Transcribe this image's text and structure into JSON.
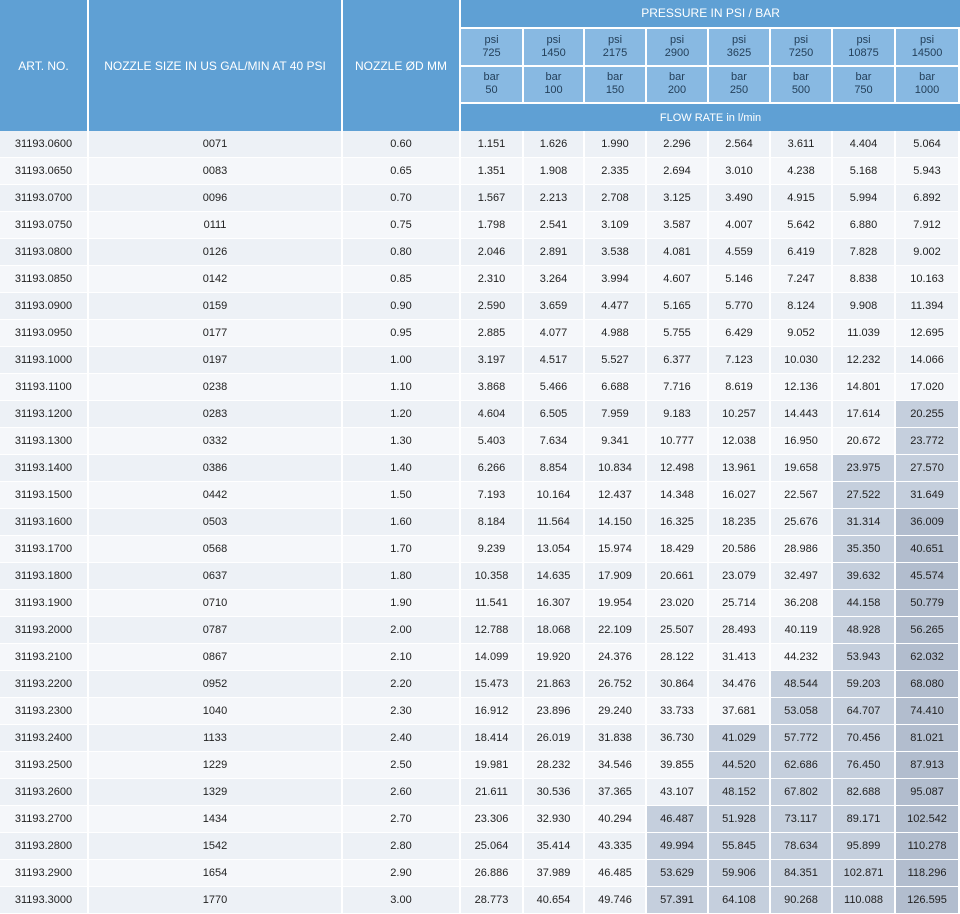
{
  "headers": {
    "art_no": "ART. NO.",
    "nozzle_size": "NOZZLE SIZE IN US GAL/MIN AT 40 PSI",
    "nozzle_d": "NOZZLE ØD MM",
    "pressure": "PRESSURE IN PSI / BAR",
    "flow_rate": "FLOW RATE in l/min",
    "pressures": [
      {
        "psi_unit": "psi",
        "psi": "725",
        "bar_unit": "bar",
        "bar": "50"
      },
      {
        "psi_unit": "psi",
        "psi": "1450",
        "bar_unit": "bar",
        "bar": "100"
      },
      {
        "psi_unit": "psi",
        "psi": "2175",
        "bar_unit": "bar",
        "bar": "150"
      },
      {
        "psi_unit": "psi",
        "psi": "2900",
        "bar_unit": "bar",
        "bar": "200"
      },
      {
        "psi_unit": "psi",
        "psi": "3625",
        "bar_unit": "bar",
        "bar": "250"
      },
      {
        "psi_unit": "psi",
        "psi": "7250",
        "bar_unit": "bar",
        "bar": "500"
      },
      {
        "psi_unit": "psi",
        "psi": "10875",
        "bar_unit": "bar",
        "bar": "750"
      },
      {
        "psi_unit": "psi",
        "psi": "14500",
        "bar_unit": "bar",
        "bar": "1000"
      }
    ]
  },
  "highlight_colors": {
    "level1": "#c5cfdd",
    "level2": "#b2bdce"
  },
  "rows": [
    {
      "art": "31193.0600",
      "size": "0071",
      "d": "0.60",
      "flows": [
        "1.151",
        "1.626",
        "1.990",
        "2.296",
        "2.564",
        "3.611",
        "4.404",
        "5.064"
      ],
      "hl": [
        0,
        0,
        0,
        0,
        0,
        0,
        0,
        0
      ]
    },
    {
      "art": "31193.0650",
      "size": "0083",
      "d": "0.65",
      "flows": [
        "1.351",
        "1.908",
        "2.335",
        "2.694",
        "3.010",
        "4.238",
        "5.168",
        "5.943"
      ],
      "hl": [
        0,
        0,
        0,
        0,
        0,
        0,
        0,
        0
      ]
    },
    {
      "art": "31193.0700",
      "size": "0096",
      "d": "0.70",
      "flows": [
        "1.567",
        "2.213",
        "2.708",
        "3.125",
        "3.490",
        "4.915",
        "5.994",
        "6.892"
      ],
      "hl": [
        0,
        0,
        0,
        0,
        0,
        0,
        0,
        0
      ]
    },
    {
      "art": "31193.0750",
      "size": "0111",
      "d": "0.75",
      "flows": [
        "1.798",
        "2.541",
        "3.109",
        "3.587",
        "4.007",
        "5.642",
        "6.880",
        "7.912"
      ],
      "hl": [
        0,
        0,
        0,
        0,
        0,
        0,
        0,
        0
      ]
    },
    {
      "art": "31193.0800",
      "size": "0126",
      "d": "0.80",
      "flows": [
        "2.046",
        "2.891",
        "3.538",
        "4.081",
        "4.559",
        "6.419",
        "7.828",
        "9.002"
      ],
      "hl": [
        0,
        0,
        0,
        0,
        0,
        0,
        0,
        0
      ]
    },
    {
      "art": "31193.0850",
      "size": "0142",
      "d": "0.85",
      "flows": [
        "2.310",
        "3.264",
        "3.994",
        "4.607",
        "5.146",
        "7.247",
        "8.838",
        "10.163"
      ],
      "hl": [
        0,
        0,
        0,
        0,
        0,
        0,
        0,
        0
      ]
    },
    {
      "art": "31193.0900",
      "size": "0159",
      "d": "0.90",
      "flows": [
        "2.590",
        "3.659",
        "4.477",
        "5.165",
        "5.770",
        "8.124",
        "9.908",
        "11.394"
      ],
      "hl": [
        0,
        0,
        0,
        0,
        0,
        0,
        0,
        0
      ]
    },
    {
      "art": "31193.0950",
      "size": "0177",
      "d": "0.95",
      "flows": [
        "2.885",
        "4.077",
        "4.988",
        "5.755",
        "6.429",
        "9.052",
        "11.039",
        "12.695"
      ],
      "hl": [
        0,
        0,
        0,
        0,
        0,
        0,
        0,
        0
      ]
    },
    {
      "art": "31193.1000",
      "size": "0197",
      "d": "1.00",
      "flows": [
        "3.197",
        "4.517",
        "5.527",
        "6.377",
        "7.123",
        "10.030",
        "12.232",
        "14.066"
      ],
      "hl": [
        0,
        0,
        0,
        0,
        0,
        0,
        0,
        0
      ]
    },
    {
      "art": "31193.1100",
      "size": "0238",
      "d": "1.10",
      "flows": [
        "3.868",
        "5.466",
        "6.688",
        "7.716",
        "8.619",
        "12.136",
        "14.801",
        "17.020"
      ],
      "hl": [
        0,
        0,
        0,
        0,
        0,
        0,
        0,
        0
      ]
    },
    {
      "art": "31193.1200",
      "size": "0283",
      "d": "1.20",
      "flows": [
        "4.604",
        "6.505",
        "7.959",
        "9.183",
        "10.257",
        "14.443",
        "17.614",
        "20.255"
      ],
      "hl": [
        0,
        0,
        0,
        0,
        0,
        0,
        0,
        1
      ]
    },
    {
      "art": "31193.1300",
      "size": "0332",
      "d": "1.30",
      "flows": [
        "5.403",
        "7.634",
        "9.341",
        "10.777",
        "12.038",
        "16.950",
        "20.672",
        "23.772"
      ],
      "hl": [
        0,
        0,
        0,
        0,
        0,
        0,
        0,
        1
      ]
    },
    {
      "art": "31193.1400",
      "size": "0386",
      "d": "1.40",
      "flows": [
        "6.266",
        "8.854",
        "10.834",
        "12.498",
        "13.961",
        "19.658",
        "23.975",
        "27.570"
      ],
      "hl": [
        0,
        0,
        0,
        0,
        0,
        0,
        1,
        1
      ]
    },
    {
      "art": "31193.1500",
      "size": "0442",
      "d": "1.50",
      "flows": [
        "7.193",
        "10.164",
        "12.437",
        "14.348",
        "16.027",
        "22.567",
        "27.522",
        "31.649"
      ],
      "hl": [
        0,
        0,
        0,
        0,
        0,
        0,
        1,
        1
      ]
    },
    {
      "art": "31193.1600",
      "size": "0503",
      "d": "1.60",
      "flows": [
        "8.184",
        "11.564",
        "14.150",
        "16.325",
        "18.235",
        "25.676",
        "31.314",
        "36.009"
      ],
      "hl": [
        0,
        0,
        0,
        0,
        0,
        0,
        1,
        2
      ]
    },
    {
      "art": "31193.1700",
      "size": "0568",
      "d": "1.70",
      "flows": [
        "9.239",
        "13.054",
        "15.974",
        "18.429",
        "20.586",
        "28.986",
        "35.350",
        "40.651"
      ],
      "hl": [
        0,
        0,
        0,
        0,
        0,
        0,
        1,
        2
      ]
    },
    {
      "art": "31193.1800",
      "size": "0637",
      "d": "1.80",
      "flows": [
        "10.358",
        "14.635",
        "17.909",
        "20.661",
        "23.079",
        "32.497",
        "39.632",
        "45.574"
      ],
      "hl": [
        0,
        0,
        0,
        0,
        0,
        0,
        1,
        2
      ]
    },
    {
      "art": "31193.1900",
      "size": "0710",
      "d": "1.90",
      "flows": [
        "11.541",
        "16.307",
        "19.954",
        "23.020",
        "25.714",
        "36.208",
        "44.158",
        "50.779"
      ],
      "hl": [
        0,
        0,
        0,
        0,
        0,
        0,
        1,
        2
      ]
    },
    {
      "art": "31193.2000",
      "size": "0787",
      "d": "2.00",
      "flows": [
        "12.788",
        "18.068",
        "22.109",
        "25.507",
        "28.493",
        "40.119",
        "48.928",
        "56.265"
      ],
      "hl": [
        0,
        0,
        0,
        0,
        0,
        0,
        1,
        2
      ]
    },
    {
      "art": "31193.2100",
      "size": "0867",
      "d": "2.10",
      "flows": [
        "14.099",
        "19.920",
        "24.376",
        "28.122",
        "31.413",
        "44.232",
        "53.943",
        "62.032"
      ],
      "hl": [
        0,
        0,
        0,
        0,
        0,
        0,
        1,
        2
      ]
    },
    {
      "art": "31193.2200",
      "size": "0952",
      "d": "2.20",
      "flows": [
        "15.473",
        "21.863",
        "26.752",
        "30.864",
        "34.476",
        "48.544",
        "59.203",
        "68.080"
      ],
      "hl": [
        0,
        0,
        0,
        0,
        0,
        1,
        1,
        2
      ]
    },
    {
      "art": "31193.2300",
      "size": "1040",
      "d": "2.30",
      "flows": [
        "16.912",
        "23.896",
        "29.240",
        "33.733",
        "37.681",
        "53.058",
        "64.707",
        "74.410"
      ],
      "hl": [
        0,
        0,
        0,
        0,
        0,
        1,
        1,
        2
      ]
    },
    {
      "art": "31193.2400",
      "size": "1133",
      "d": "2.40",
      "flows": [
        "18.414",
        "26.019",
        "31.838",
        "36.730",
        "41.029",
        "57.772",
        "70.456",
        "81.021"
      ],
      "hl": [
        0,
        0,
        0,
        0,
        1,
        1,
        1,
        2
      ]
    },
    {
      "art": "31193.2500",
      "size": "1229",
      "d": "2.50",
      "flows": [
        "19.981",
        "28.232",
        "34.546",
        "39.855",
        "44.520",
        "62.686",
        "76.450",
        "87.913"
      ],
      "hl": [
        0,
        0,
        0,
        0,
        1,
        1,
        1,
        2
      ]
    },
    {
      "art": "31193.2600",
      "size": "1329",
      "d": "2.60",
      "flows": [
        "21.611",
        "30.536",
        "37.365",
        "43.107",
        "48.152",
        "67.802",
        "82.688",
        "95.087"
      ],
      "hl": [
        0,
        0,
        0,
        0,
        1,
        1,
        1,
        2
      ]
    },
    {
      "art": "31193.2700",
      "size": "1434",
      "d": "2.70",
      "flows": [
        "23.306",
        "32.930",
        "40.294",
        "46.487",
        "51.928",
        "73.117",
        "89.171",
        "102.542"
      ],
      "hl": [
        0,
        0,
        0,
        1,
        1,
        1,
        1,
        2
      ]
    },
    {
      "art": "31193.2800",
      "size": "1542",
      "d": "2.80",
      "flows": [
        "25.064",
        "35.414",
        "43.335",
        "49.994",
        "55.845",
        "78.634",
        "95.899",
        "110.278"
      ],
      "hl": [
        0,
        0,
        0,
        1,
        1,
        1,
        1,
        2
      ]
    },
    {
      "art": "31193.2900",
      "size": "1654",
      "d": "2.90",
      "flows": [
        "26.886",
        "37.989",
        "46.485",
        "53.629",
        "59.906",
        "84.351",
        "102.871",
        "118.296"
      ],
      "hl": [
        0,
        0,
        0,
        1,
        1,
        1,
        1,
        2
      ]
    },
    {
      "art": "31193.3000",
      "size": "1770",
      "d": "3.00",
      "flows": [
        "28.773",
        "40.654",
        "49.746",
        "57.391",
        "64.108",
        "90.268",
        "110.088",
        "126.595"
      ],
      "hl": [
        0,
        0,
        0,
        1,
        1,
        1,
        1,
        2
      ]
    }
  ]
}
